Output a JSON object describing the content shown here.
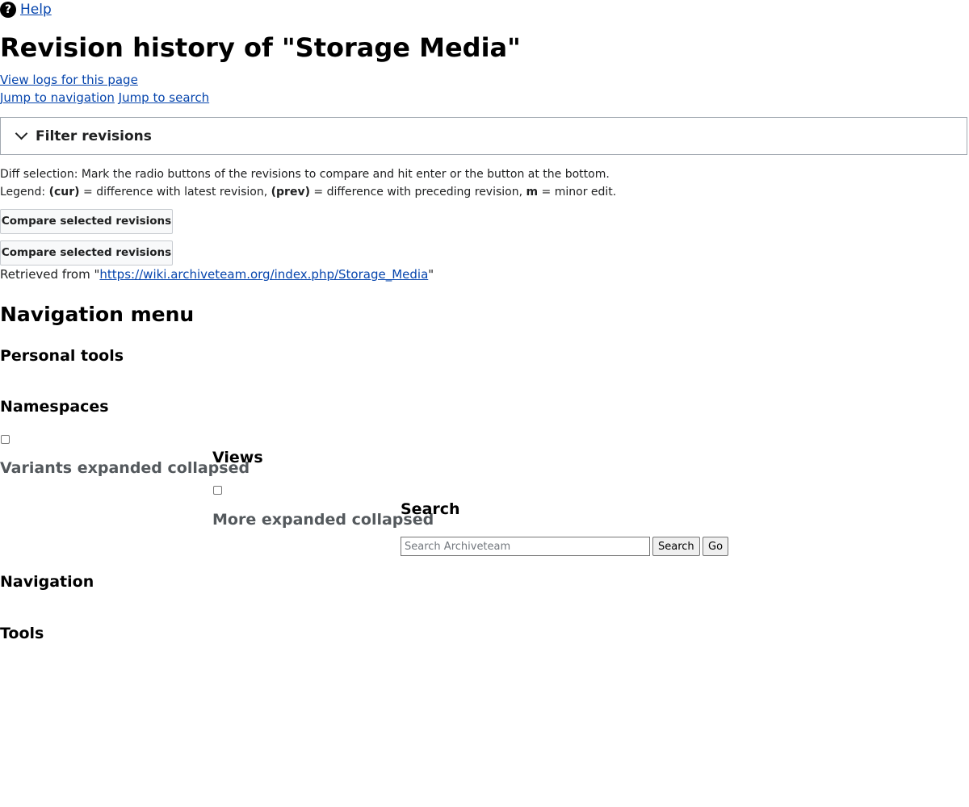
{
  "help": {
    "icon": "help-circle-icon",
    "label": "Help"
  },
  "page_title": "Revision history of \"Storage Media\"",
  "links": {
    "view_logs": "View logs for this page",
    "jump_navigation": "Jump to navigation",
    "jump_search": "Jump to search"
  },
  "filter": {
    "icon": "chevron-down-icon",
    "label": "Filter revisions"
  },
  "diff_selection": "Diff selection: Mark the radio buttons of the revisions to compare and hit enter or the button at the bottom.",
  "legend": {
    "prefix": "Legend: ",
    "cur": "(cur)",
    "cur_desc": " = difference with latest revision, ",
    "prev": "(prev)",
    "prev_desc": " = difference with preceding revision, ",
    "minor": "m",
    "minor_desc": " = minor edit."
  },
  "compare_button_label": "Compare selected revisions",
  "retrieved": {
    "prefix": "Retrieved from \"",
    "url": "https://wiki.archiveteam.org/index.php/Storage_Media",
    "suffix": "\""
  },
  "navigation_menu": "Navigation menu",
  "personal_tools": "Personal tools",
  "namespaces": "Namespaces",
  "variants": "Variants expanded collapsed",
  "views": "Views",
  "more": "More expanded collapsed",
  "search": {
    "heading": "Search",
    "placeholder": "Search Archiveteam",
    "search_button": "Search",
    "go_button": "Go"
  },
  "navigation": "Navigation",
  "tools": "Tools"
}
